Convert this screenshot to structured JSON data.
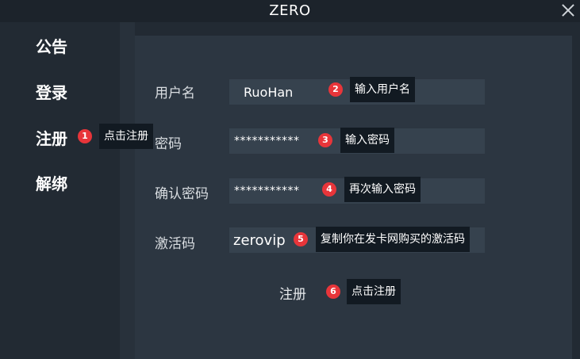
{
  "window": {
    "title": "ZERO",
    "close_icon": "close-icon"
  },
  "sidebar": {
    "items": [
      {
        "label": "公告"
      },
      {
        "label": "登录"
      },
      {
        "label": "注册"
      },
      {
        "label": "解绑"
      }
    ]
  },
  "form": {
    "username": {
      "label": "用户名",
      "value": "RuoHan"
    },
    "password": {
      "label": "密码",
      "value": "***********"
    },
    "confirm_password": {
      "label": "确认密码",
      "value": "***********"
    },
    "activation_code": {
      "label": "激活码",
      "value": "zerovip"
    },
    "submit_label": "注册"
  },
  "annotations": [
    {
      "number": "1",
      "text": "点击注册"
    },
    {
      "number": "2",
      "text": "输入用户名"
    },
    {
      "number": "3",
      "text": "输入密码"
    },
    {
      "number": "4",
      "text": "再次输入密码"
    },
    {
      "number": "5",
      "text": "复制你在发卡网购买的激活码"
    },
    {
      "number": "6",
      "text": "点击注册"
    }
  ],
  "colors": {
    "background": "#222a33",
    "panel": "#2c3641",
    "field": "#36424e",
    "marker": "#e8353a",
    "tooltip": "#121a22"
  }
}
